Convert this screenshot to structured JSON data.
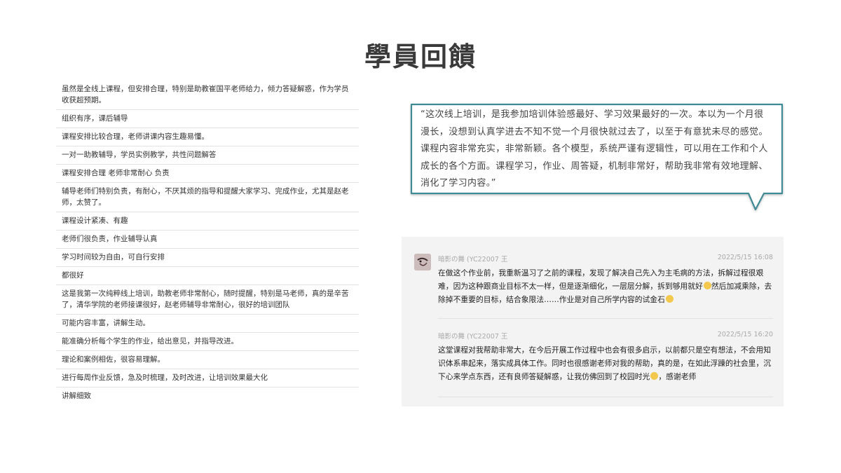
{
  "title": "學員回饋",
  "feedback_list": [
    "虽然是全线上课程，但安排合理，特别是助教崔国平老师给力，倾力答疑解惑，作为学员收获超预期。",
    "组织有序，课后辅导",
    "课程安排比较合理，老师讲课内容生趣易懂。",
    "一对一助教辅导，学员实例教学，共性问题解答",
    "课程安排合理 老师非常耐心 负责",
    "辅导老师们特别负责，有耐心，不厌其烦的指导和提醒大家学习、完成作业，尤其是赵老师，太赞了。",
    "课程设计紧凑、有趣",
    "老师们很负责，作业辅导认真",
    "学习时间较为自由，可自行安排",
    "都很好",
    "这是我第一次纯粹线上培训，助教老师非常耐心，随时提醒，特别是马老师，真的是辛苦了，清华学院的老师接课很好，赵老师辅导非常耐心，很好的培训团队",
    "可能内容丰富，讲解生动。",
    "能准确分析每个学生的作业，给出意见，并指导改进。",
    "理论和案例相佐，很容易理解。",
    "进行每周作业反馈，急及时梳理，及时改进，让培训效果最大化",
    "讲解细致"
  ],
  "quote": "“这次线上培训，是我参加培训体验感最好、学习效果最好的一次。本以为一个月很漫长，没想到认真学进去不知不觉一个月很快就过去了，以至于有意犹未尽的感觉。课程内容非常充实，非常新颖。各个模型，系统严谨有逻辑性，可以用在工作和个人成长的各个方面。课程学习，作业、周答疑，机制非常好，帮助我非常有效地理解、消化了学习内容。”",
  "chat": {
    "messages": [
      {
        "sender": "暗影の舞 (YC22007 王",
        "time": "2022/5/15 16:08",
        "text": "在做这个作业前，我重新温习了之前的课程，发现了解决自己先入为主毛病的方法，拆解过程很艰难，因为这种跟商业目标不太一样，但是逐渐细化，一层层分解，拆到够用就好",
        "text_tail": "然后加减乘除，去除掉不重要的目标，结合象限法……作业是对自己所学内容的试金石"
      },
      {
        "sender": "暗影の舞 (YC22007 王",
        "time": "2022/5/15 16:20",
        "text": "这堂课程对我帮助非常大，在今后开展工作过程中也会有很多启示，以前都只是空有想法，不会用知识体系串起来，落实成具体工作。同时也很感谢老师对我的帮助，真的是，在如此浮躁的社会里，沉下心来学点东西，还有良师答疑解惑，让我仿佛回到了校园时光",
        "text_tail": "，感谢老师"
      }
    ]
  },
  "colors": {
    "bubble_border": "#3f8a94",
    "chat_bg": "#f3f3f3",
    "emoji": "#f2c94c"
  }
}
